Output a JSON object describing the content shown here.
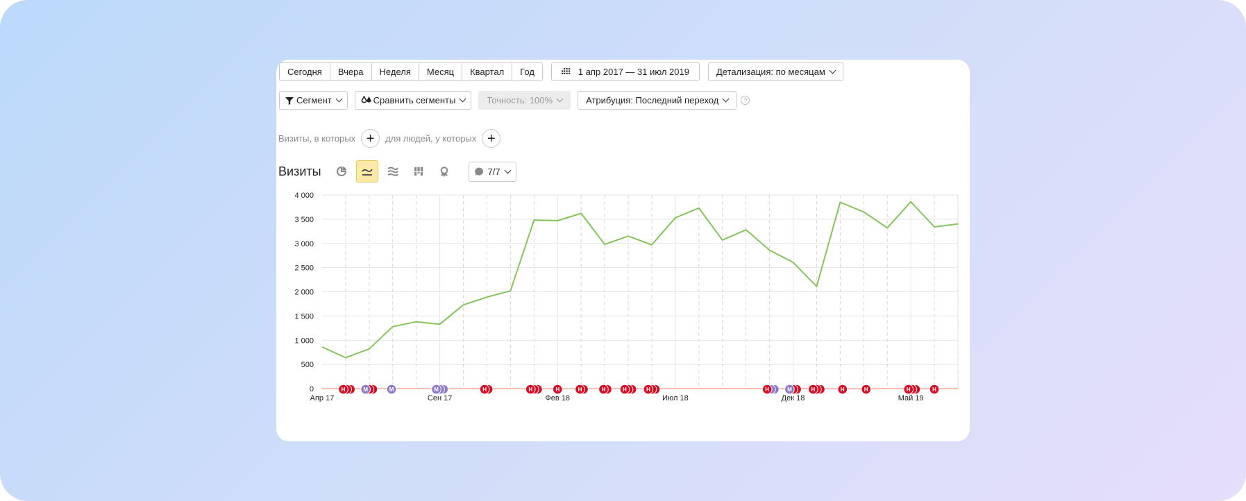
{
  "toolbar": {
    "periods": [
      "Сегодня",
      "Вчера",
      "Неделя",
      "Месяц",
      "Квартал",
      "Год"
    ],
    "date_range": "1 апр 2017 — 31 июл 2019",
    "detail": "Детализация: по месяцам",
    "segment": "Сегмент",
    "compare": "Сравнить сегменты",
    "accuracy": "Точность: 100%",
    "attribution": "Атрибуция: Последний переход",
    "help": "?"
  },
  "segment_builder": {
    "visits_label": "Визиты, в которых",
    "people_label": "для людей, у которых",
    "add": "+"
  },
  "report": {
    "title": "Визиты",
    "notes_count": "7/7"
  },
  "icons": {
    "calendar": "calendar-icon",
    "filter": "filter-icon",
    "compare": "compare-segments-icon",
    "pie": "pie-chart-icon",
    "line": "line-chart-icon",
    "area": "area-chart-icon",
    "bar": "bar-chart-icon",
    "map": "map-icon",
    "notes": "comment-icon"
  },
  "colors": {
    "line": "#86c45b",
    "note_red": "#d80d24",
    "note_purple": "#8b78cb",
    "baseline": "#f0a59a",
    "active_tab": "#fde9a7"
  },
  "chart_data": {
    "type": "line",
    "title": "",
    "xlabel": "",
    "ylabel": "",
    "ylim": [
      0,
      4000
    ],
    "yticks": [
      "0",
      "500",
      "1 000",
      "1 500",
      "2 000",
      "2 500",
      "3 000",
      "3 500",
      "4 000"
    ],
    "x_tick_labels": [
      {
        "index": 0,
        "label": "Апр 17"
      },
      {
        "index": 5,
        "label": "Сен 17"
      },
      {
        "index": 10,
        "label": "Фев 18"
      },
      {
        "index": 15,
        "label": "Июл 18"
      },
      {
        "index": 20,
        "label": "Дек 18"
      },
      {
        "index": 25,
        "label": "Май 19"
      }
    ],
    "x": [
      "Апр 17",
      "Май 17",
      "Июн 17",
      "Июл 17",
      "Авг 17",
      "Сен 17",
      "Окт 17",
      "Ноя 17",
      "Дек 17",
      "Янв 18",
      "Фев 18",
      "Мар 18",
      "Апр 18",
      "Май 18",
      "Июн 18",
      "Июл 18",
      "Авг 18",
      "Сен 18",
      "Окт 18",
      "Ноя 18",
      "Дек 18",
      "Янв 19",
      "Фев 19",
      "Мар 19",
      "Апр 19",
      "Май 19",
      "Июн 19",
      "Июл 19"
    ],
    "series": [
      {
        "values": [
          860,
          640,
          820,
          1280,
          1380,
          1330,
          1730,
          1890,
          2020,
          3480,
          3470,
          3620,
          2980,
          3150,
          2970,
          3530,
          3730,
          3070,
          3280,
          2860,
          2610,
          2110,
          3850,
          3650,
          3320,
          3860,
          3340,
          3400
        ]
      }
    ],
    "grid": true,
    "notes": [
      {
        "type": "red",
        "x": 0.9,
        "label": "Н"
      },
      {
        "type": "red",
        "x": 1.05
      },
      {
        "type": "red",
        "x": 1.2
      },
      {
        "type": "purple",
        "x": 1.85,
        "label": "М"
      },
      {
        "type": "red",
        "x": 2.0
      },
      {
        "type": "red",
        "x": 2.15
      },
      {
        "type": "purple",
        "x": 2.95,
        "label": "М"
      },
      {
        "type": "purple",
        "x": 4.85,
        "label": "М"
      },
      {
        "type": "purple",
        "x": 5.0
      },
      {
        "type": "purple",
        "x": 5.15
      },
      {
        "type": "red",
        "x": 6.9,
        "label": "Н"
      },
      {
        "type": "red",
        "x": 7.05
      },
      {
        "type": "red",
        "x": 8.85,
        "label": "Н"
      },
      {
        "type": "red",
        "x": 9.0
      },
      {
        "type": "red",
        "x": 9.15
      },
      {
        "type": "red",
        "x": 10.0,
        "label": "Н"
      },
      {
        "type": "red",
        "x": 10.95,
        "label": "Н"
      },
      {
        "type": "red",
        "x": 11.1
      },
      {
        "type": "red",
        "x": 11.95,
        "label": "Н"
      },
      {
        "type": "red",
        "x": 12.1
      },
      {
        "type": "red",
        "x": 12.85,
        "label": "Н"
      },
      {
        "type": "red",
        "x": 13.0
      },
      {
        "type": "red",
        "x": 13.15
      },
      {
        "type": "red",
        "x": 13.85,
        "label": "Н"
      },
      {
        "type": "red",
        "x": 14.0
      },
      {
        "type": "red",
        "x": 14.15
      },
      {
        "type": "red",
        "x": 18.9,
        "label": "Н"
      },
      {
        "type": "purple",
        "x": 19.05
      },
      {
        "type": "purple",
        "x": 19.2
      },
      {
        "type": "purple",
        "x": 19.85,
        "label": "М"
      },
      {
        "type": "red",
        "x": 20.0
      },
      {
        "type": "red",
        "x": 20.15
      },
      {
        "type": "red",
        "x": 20.85,
        "label": "Н"
      },
      {
        "type": "red",
        "x": 21.0
      },
      {
        "type": "red",
        "x": 21.15
      },
      {
        "type": "red",
        "x": 22.1,
        "label": "Н"
      },
      {
        "type": "red",
        "x": 23.1,
        "label": "Н"
      },
      {
        "type": "red",
        "x": 24.9,
        "label": "Н"
      },
      {
        "type": "red",
        "x": 25.05
      },
      {
        "type": "red",
        "x": 25.2
      },
      {
        "type": "red",
        "x": 26.0,
        "label": "Н"
      }
    ]
  }
}
